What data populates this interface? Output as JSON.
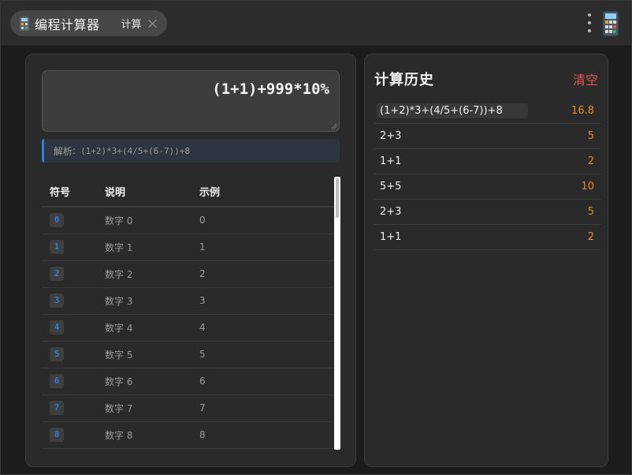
{
  "titlebar": {
    "app_tab_label": "编程计算器",
    "calc_tab_label": "计算"
  },
  "calculator": {
    "expression": "(1+1)+999*10%",
    "parse_label": "解析",
    "parse_separator": ":",
    "parse_expression": "(1+2)*3+(4/5+(6-7))+8"
  },
  "symbols_table": {
    "headers": [
      "符号",
      "说明",
      "示例"
    ],
    "rows": [
      {
        "symbol": "0",
        "desc": "数字 0",
        "example": "0"
      },
      {
        "symbol": "1",
        "desc": "数字 1",
        "example": "1"
      },
      {
        "symbol": "2",
        "desc": "数字 2",
        "example": "2"
      },
      {
        "symbol": "3",
        "desc": "数字 3",
        "example": "3"
      },
      {
        "symbol": "4",
        "desc": "数字 4",
        "example": "4"
      },
      {
        "symbol": "5",
        "desc": "数字 5",
        "example": "5"
      },
      {
        "symbol": "6",
        "desc": "数字 6",
        "example": "6"
      },
      {
        "symbol": "7",
        "desc": "数字 7",
        "example": "7"
      },
      {
        "symbol": "8",
        "desc": "数字 8",
        "example": "8"
      }
    ]
  },
  "history": {
    "title": "计算历史",
    "clear_label": "清空",
    "items": [
      {
        "expr": "(1+2)*3+(4/5+(6-7))+8",
        "value": "16.8"
      },
      {
        "expr": "2+3",
        "value": "5"
      },
      {
        "expr": "1+1",
        "value": "2"
      },
      {
        "expr": "5+5",
        "value": "10"
      },
      {
        "expr": "2+3",
        "value": "5"
      },
      {
        "expr": "1+1",
        "value": "2"
      }
    ]
  },
  "colors": {
    "accent": "#2f7fd8",
    "result": "#f08a1c",
    "danger": "#e5534b"
  }
}
